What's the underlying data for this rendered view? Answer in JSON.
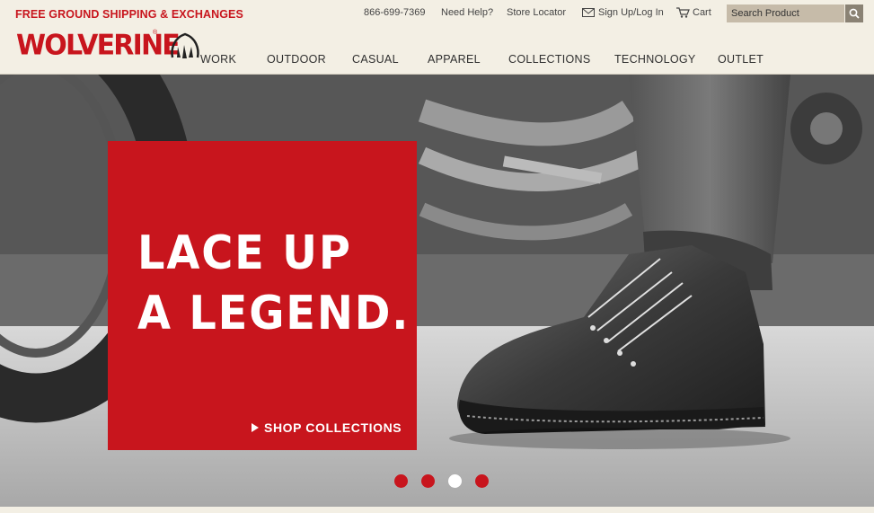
{
  "header": {
    "promo": "FREE GROUND SHIPPING & EXCHANGES",
    "logo": "WOLVERINE",
    "phone": "866-699-7369",
    "need_help": "Need Help?",
    "store_locator": "Store Locator",
    "sign_in": "Sign Up/Log In",
    "cart": "Cart",
    "search_placeholder": "Search Product"
  },
  "nav": [
    "WORK",
    "OUTDOOR",
    "CASUAL",
    "APPAREL",
    "COLLECTIONS",
    "TECHNOLOGY",
    "OUTLET"
  ],
  "hero": {
    "headline": "LACE UP\nA LEGEND.",
    "cta": "SHOP COLLECTIONS",
    "slides": 4,
    "active_slide": 3
  },
  "colors": {
    "brand_red": "#c8151d",
    "header_bg": "#f3efe4",
    "search_bg": "#c6bba9"
  },
  "icons": [
    "claw-logo-icon",
    "envelope-icon",
    "cart-icon",
    "search-icon",
    "play-arrow-icon"
  ]
}
